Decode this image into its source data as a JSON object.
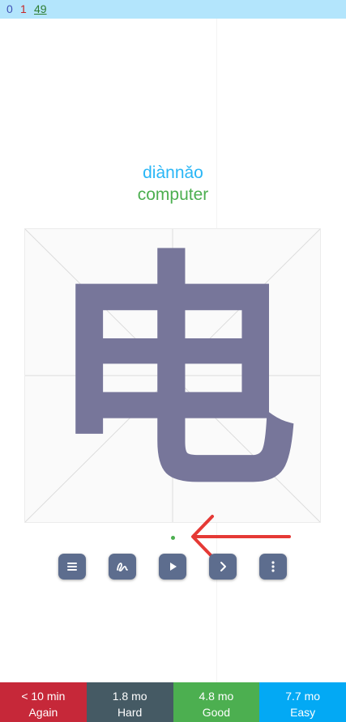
{
  "counts": {
    "new": "0",
    "learn": "1",
    "review": "49"
  },
  "card": {
    "pinyin": "diànnǎo",
    "meaning": "computer",
    "character": "电"
  },
  "toolbar": {
    "buttons": [
      "menu-icon",
      "stroke-order-icon",
      "play-icon",
      "next-icon",
      "more-vertical-icon"
    ]
  },
  "answers": [
    {
      "interval": "< 10 min",
      "label": "Again",
      "color": "#c62839"
    },
    {
      "interval": "1.8 mo",
      "label": "Hard",
      "color": "#455a64"
    },
    {
      "interval": "4.8 mo",
      "label": "Good",
      "color": "#4caf50"
    },
    {
      "interval": "7.7 mo",
      "label": "Easy",
      "color": "#03a9f4"
    }
  ],
  "colors": {
    "topbar": "#b3e5fc",
    "pinyin": "#29b6f6",
    "meaning": "#4caf50",
    "character": "#77769a",
    "tool_button": "#5d6d8e",
    "arrow": "#e53935"
  }
}
